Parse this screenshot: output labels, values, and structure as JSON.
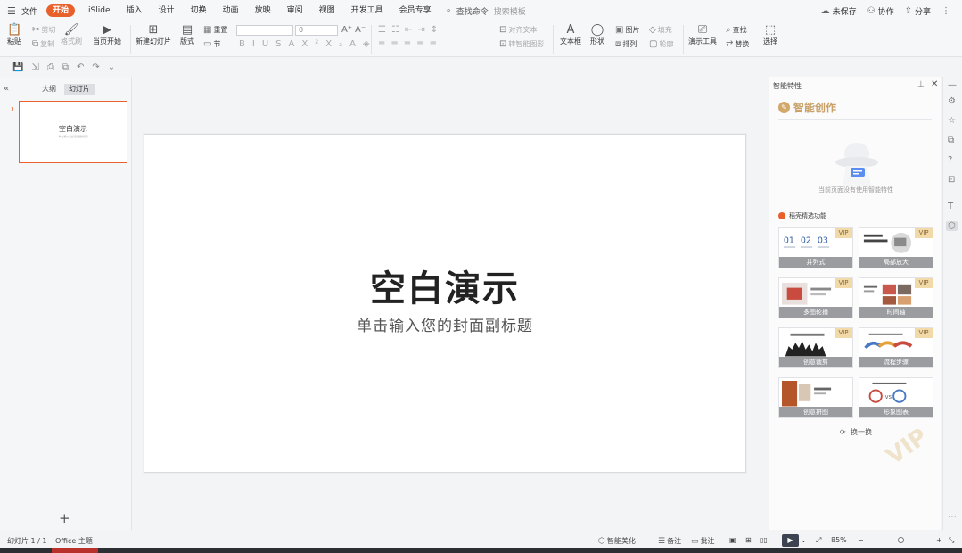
{
  "menubar": {
    "file": "文件",
    "tabs": [
      "开始",
      "iSlide",
      "插入",
      "设计",
      "切换",
      "动画",
      "放映",
      "审阅",
      "视图",
      "开发工具",
      "会员专享"
    ],
    "search_cmd": "查找命令",
    "search_template": "搜索模板",
    "unsaved": "未保存",
    "collab": "协作",
    "share": "分享"
  },
  "ribbon": {
    "paste": "粘贴",
    "cut": "剪切",
    "copy": "复制",
    "format_painter": "格式刷",
    "from_current": "当页开始",
    "new_slide": "新建幻灯片",
    "layout": "版式",
    "section": "节",
    "reset": "重置",
    "font_size": "0",
    "align_text": "对齐文本",
    "to_smartart": "转智能图形",
    "textbox": "文本框",
    "shape": "形状",
    "picture": "图片",
    "arrange": "排列",
    "fill": "填充",
    "outline": "轮廓",
    "presentation_tools": "演示工具",
    "find": "查找",
    "replace": "替换",
    "select": "选择"
  },
  "left_panel": {
    "outline_tab": "大纲",
    "slides_tab": "幻灯片",
    "slide_number": "1",
    "thumb_title": "空白演示",
    "thumb_subtitle": "单击输入您的封面副标题"
  },
  "slide": {
    "title": "空白演示",
    "subtitle": "单击输入您的封面副标题"
  },
  "smart_panel": {
    "header": "智能特性",
    "brand": "智能创作",
    "empty_hint": "当前页面没有使用智能特性",
    "section": "稻壳精选功能",
    "vip_label": "VIP",
    "cards": [
      {
        "caption": "并列式"
      },
      {
        "caption": "局部放大"
      },
      {
        "caption": "多图轮播"
      },
      {
        "caption": "时间轴"
      },
      {
        "caption": "创意裁剪"
      },
      {
        "caption": "流程步骤"
      },
      {
        "caption": "创意拼图"
      },
      {
        "caption": "形象图表"
      }
    ],
    "refresh": "换一换"
  },
  "status": {
    "slide_info": "幻灯片 1 / 1",
    "theme": "Office 主题",
    "beautify": "智能美化",
    "notes": "备注",
    "comments": "批注",
    "zoom": "85%"
  },
  "colors": {
    "accent": "#e8602c",
    "gold": "#c9a169"
  }
}
